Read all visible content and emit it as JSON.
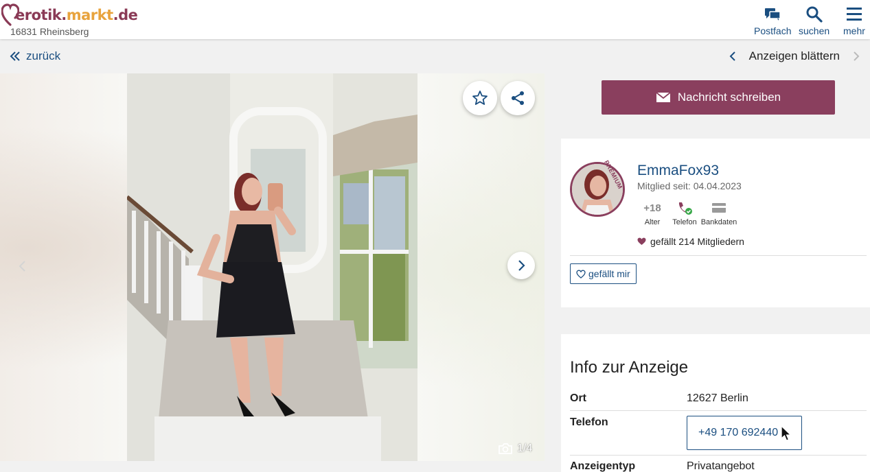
{
  "header": {
    "logo_part1": "erotik.",
    "logo_part2": "markt",
    "logo_part3": ".de",
    "location": "16831 Rheinsberg",
    "nav": [
      {
        "label": "Postfach",
        "icon": "chat-icon"
      },
      {
        "label": "suchen",
        "icon": "search-icon"
      },
      {
        "label": "mehr",
        "icon": "menu-icon"
      }
    ]
  },
  "subbar": {
    "back_label": "zurück",
    "browse_label": "Anzeigen blättern"
  },
  "gallery": {
    "counter": "1/4",
    "current_image": 1,
    "total_images": 4
  },
  "cta": {
    "label": "Nachricht schreiben"
  },
  "profile": {
    "badge": "PREMIUM",
    "username": "EmmaFox93",
    "member_since": "Mitglied seit: 04.04.2023",
    "stats": [
      {
        "value": "+18",
        "label": "Alter"
      },
      {
        "value": "",
        "label": "Telefon",
        "icon": "phone-verified-icon"
      },
      {
        "value": "",
        "label": "Bankdaten",
        "icon": "card-icon"
      }
    ],
    "likes": "gefällt 214 Mitgliedern",
    "like_button": "gefällt mir"
  },
  "info": {
    "title": "Info zur Anzeige",
    "rows": [
      {
        "key": "Ort",
        "value": "12627 Berlin"
      },
      {
        "key": "Telefon",
        "value": "+49 170 692440"
      },
      {
        "key": "Anzeigentyp",
        "value": "Privatangebot"
      }
    ]
  },
  "colors": {
    "brand": "#8a3f5e",
    "link": "#1a4e80",
    "logo_accent": "#e8a33d"
  }
}
